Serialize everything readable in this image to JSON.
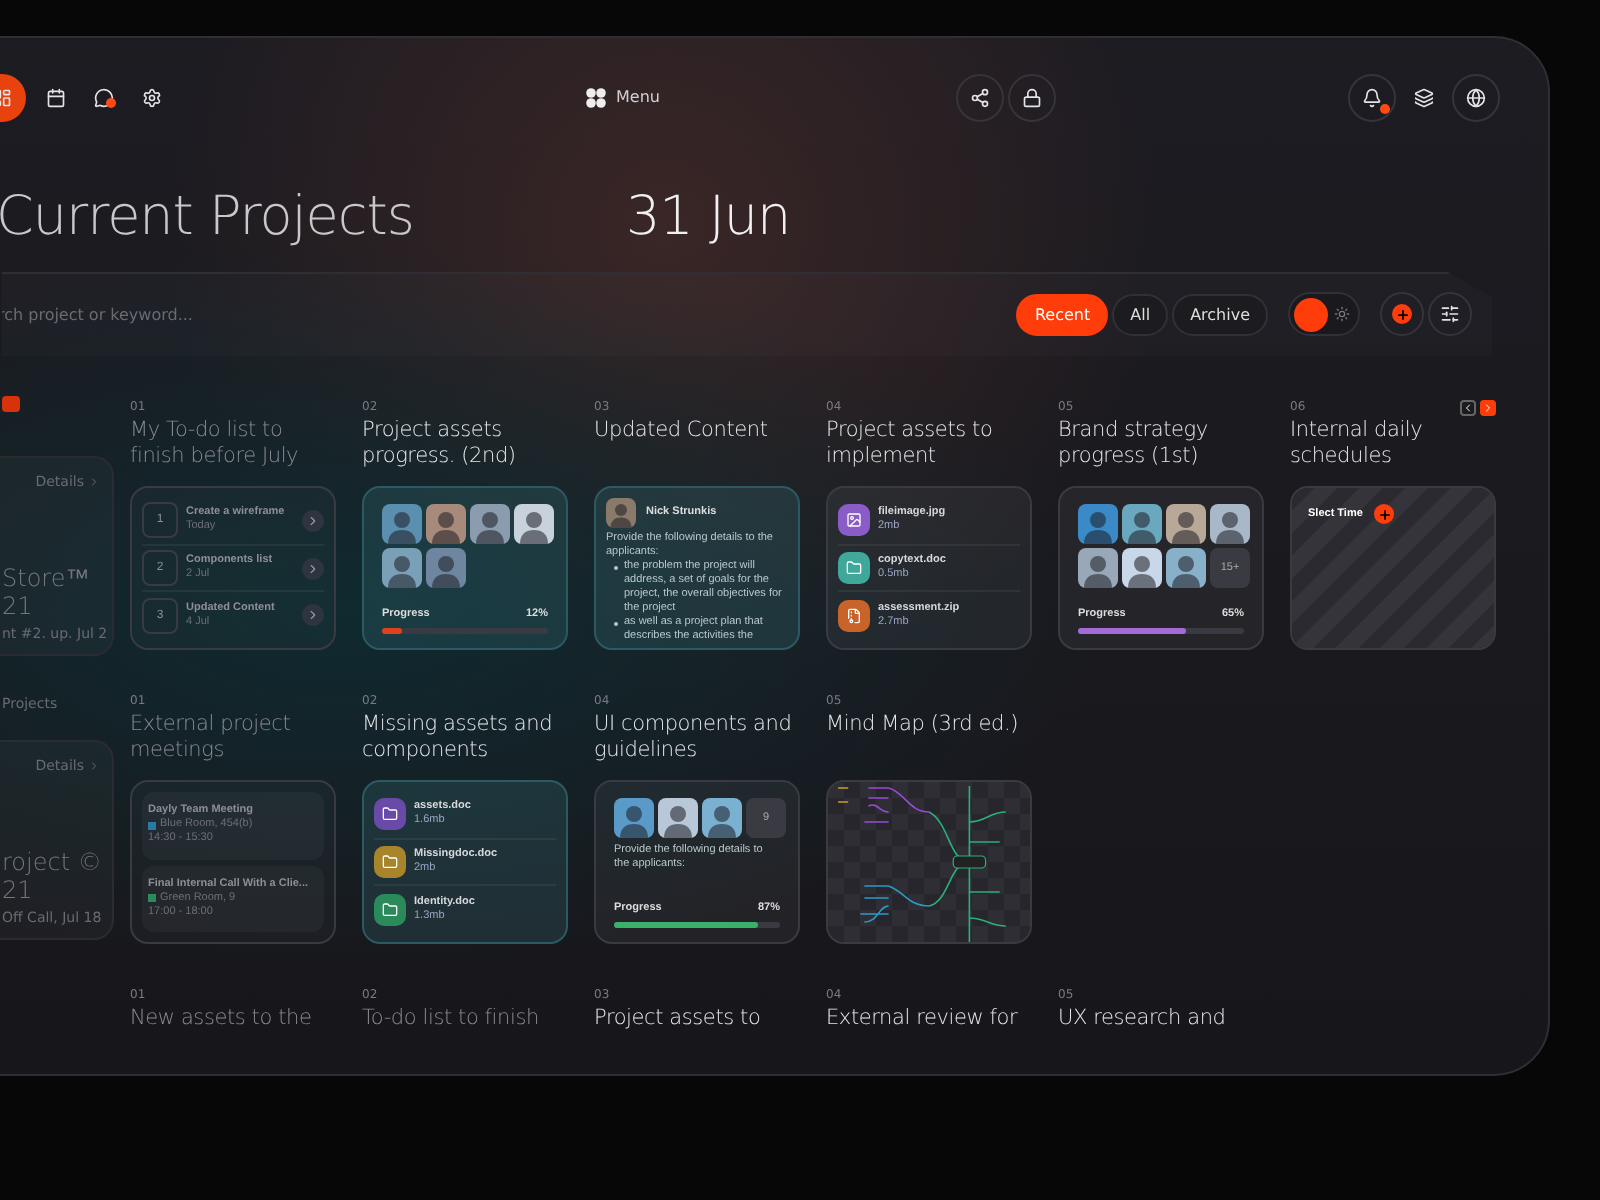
{
  "topbar": {
    "left": [
      {
        "kind": "home",
        "selected": true,
        "badge": false
      },
      {
        "kind": "calendar",
        "selected": false,
        "badge": false
      },
      {
        "kind": "chat",
        "selected": false,
        "badge": true
      },
      {
        "kind": "settings",
        "selected": false,
        "badge": false
      }
    ],
    "menu": {
      "label": "Menu"
    },
    "center": [
      {
        "kind": "share",
        "badge": false
      },
      {
        "kind": "lock",
        "badge": false
      }
    ],
    "right": [
      {
        "kind": "bell",
        "badge": true
      },
      {
        "kind": "layers",
        "badge": false
      },
      {
        "kind": "globe",
        "badge": false
      }
    ]
  },
  "header": {
    "title": "Current Projects",
    "date": "31 Jun"
  },
  "toolbar": {
    "search": {
      "placeholder": "rch project or keyword..."
    },
    "filters": [
      {
        "label": "Recent",
        "selected": true
      },
      {
        "label": "All",
        "selected": false
      },
      {
        "label": "Archive",
        "selected": false
      }
    ],
    "dark_mode": true,
    "actions": [
      {
        "kind": "add"
      },
      {
        "kind": "filter"
      }
    ]
  },
  "sidebar": {
    "items": [
      {
        "kind": "card",
        "link": "Details",
        "lines": [
          "Store™",
          "21"
        ],
        "subtitle": "nt #2. up. Jul 2"
      },
      {
        "kind": "label",
        "text": "Projects"
      },
      {
        "kind": "card",
        "link": "Details",
        "lines": [
          "roject ©",
          "21"
        ],
        "subtitle": "Off Call, Jul 18"
      }
    ]
  },
  "rows": [
    {
      "cards": [
        {
          "number": "01",
          "title": "My To-do list to finish before July",
          "faded": true,
          "content": {
            "kind": "todo",
            "items": [
              {
                "number": "1",
                "title": "Create a wireframe",
                "date": "Today"
              },
              {
                "number": "2",
                "title": "Components list",
                "date": "2 Jul"
              },
              {
                "number": "3",
                "title": "Updated Content",
                "date": "4 Jul"
              }
            ]
          }
        },
        {
          "number": "02",
          "title": "Project assets progress. (2nd)",
          "faded": false,
          "content": {
            "kind": "team",
            "accent": true,
            "avatars": [
              {
                "color": "#5b8fb0"
              },
              {
                "color": "#a88a7a"
              },
              {
                "color": "#8a9cae"
              },
              {
                "color": "#c8d2dc"
              },
              {
                "color": "#7aa0b8"
              },
              {
                "color": "#6e86a0"
              }
            ],
            "progress": {
              "label": "Progress",
              "value": "12%",
              "level": 0.12,
              "color": "#e0401a"
            }
          }
        },
        {
          "number": "03",
          "title": "Updated Content",
          "faded": false,
          "content": {
            "kind": "message",
            "author": "Nick Strunkis",
            "text": "Provide the following details to the applicants:",
            "bullets": [
              "the problem the project will address, a set of goals for the project, the overall objectives for the project",
              "as well as a project plan that describes the activities the"
            ]
          }
        },
        {
          "number": "04",
          "title": "Project assets to implement",
          "faded": false,
          "content": {
            "kind": "files",
            "accent": false,
            "files": [
              {
                "name": "fileimage.jpg",
                "size": "2mb",
                "kind": "image",
                "color": "#8a5cc8"
              },
              {
                "name": "copytext.doc",
                "size": "0.5mb",
                "kind": "folder",
                "color": "#3fa89a"
              },
              {
                "name": "assessment.zip",
                "size": "2.7mb",
                "kind": "archive",
                "color": "#c8642a"
              }
            ]
          }
        },
        {
          "number": "05",
          "title": "Brand strategy progress (1st)",
          "faded": false,
          "content": {
            "kind": "team",
            "accent": false,
            "avatars": [
              {
                "color": "#3a8ac8"
              },
              {
                "color": "#6aa8c0"
              },
              {
                "color": "#b8a898"
              },
              {
                "color": "#a8b8c8"
              },
              {
                "color": "#98a8b8"
              },
              {
                "color": "#c8d8e8"
              },
              {
                "color": "#88b0c8"
              }
            ],
            "extra": "15+",
            "progress": {
              "label": "Progress",
              "value": "65%",
              "level": 0.65,
              "color": "#a46ad8"
            }
          }
        },
        {
          "number": "06",
          "title": "Internal daily schedules",
          "faded": false,
          "pager": [
            {
              "kind": "prev",
              "selected": false
            },
            {
              "kind": "next",
              "selected": true
            }
          ],
          "content": {
            "kind": "timeslot",
            "label": "Slect Time"
          }
        }
      ]
    },
    {
      "cards": [
        {
          "number": "01",
          "title": "External project meetings",
          "faded": true,
          "content": {
            "kind": "meetings",
            "items": [
              {
                "title": "Dayly Team Meeting",
                "room": "Blue Room, 454(b)",
                "color": "#2a7aa8",
                "time": "14:30 - 15:30"
              },
              {
                "title": "Final Internal Call With a Clie...",
                "room": "Green Room, 9",
                "color": "#2a8a5a",
                "time": "17:00 - 18:00"
              }
            ]
          }
        },
        {
          "number": "02",
          "title": "Missing assets and components",
          "faded": false,
          "content": {
            "kind": "files",
            "accent": true,
            "files": [
              {
                "name": "assets.doc",
                "size": "1.6mb",
                "kind": "folder",
                "color": "#6a4aa8"
              },
              {
                "name": "Missingdoc.doc",
                "size": "2mb",
                "kind": "folder",
                "color": "#a8842a"
              },
              {
                "name": "Identity.doc",
                "size": "1.3mb",
                "kind": "folder",
                "color": "#2a8a5a"
              }
            ]
          }
        },
        {
          "number": "04",
          "title": "UI components and guidelines",
          "faded": false,
          "content": {
            "kind": "brief",
            "avatars": [
              {
                "color": "#5a9ac8"
              },
              {
                "color": "#b8c8d8"
              },
              {
                "color": "#7ab0d0"
              }
            ],
            "extra": "9",
            "text": "Provide the following details to the applicants:",
            "progress": {
              "label": "Progress",
              "value": "87%",
              "level": 0.87,
              "color": "#3ab06a"
            }
          }
        },
        {
          "number": "05",
          "title": "Mind Map (3rd ed.)",
          "faded": false,
          "content": {
            "kind": "mindmap"
          }
        }
      ]
    },
    {
      "cards": [
        {
          "number": "01",
          "title": "New assets to the",
          "faded": true
        },
        {
          "number": "02",
          "title": "To-do list to finish",
          "faded": true
        },
        {
          "number": "03",
          "title": "Project assets to",
          "faded": false
        },
        {
          "number": "04",
          "title": "External review for",
          "faded": false
        },
        {
          "number": "05",
          "title": "UX research and",
          "faded": false
        }
      ]
    }
  ]
}
